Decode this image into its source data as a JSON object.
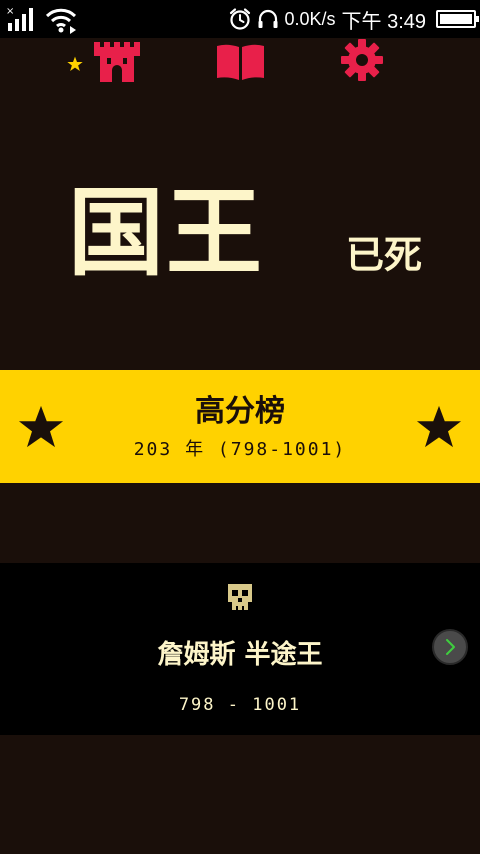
{
  "colors": {
    "background": "#1a0f0a",
    "accent_red": "#e8204a",
    "banner_yellow": "#ffd200",
    "cream_text": "#fdf5c9",
    "skull": "#d8c98a",
    "next_arrow": "#3ecf3e"
  },
  "status_bar": {
    "net_speed": "0.0K/s",
    "time": "下午 3:49",
    "battery_level": 1.0,
    "icons": [
      "signal-icon",
      "wifi-icon",
      "alarm-icon",
      "headset-icon",
      "battery-icon"
    ]
  },
  "toolbar": {
    "icons": [
      "star-icon",
      "castle-icon",
      "book-icon",
      "gear-icon"
    ]
  },
  "title": {
    "main": "国王",
    "sub": "已死"
  },
  "highscore": {
    "label": "高分榜",
    "years": "203 年 (798-1001)",
    "icons": [
      "star-icon",
      "star-icon"
    ]
  },
  "record": {
    "icon": "skull-icon",
    "name": "詹姆斯  半途王",
    "years": "798 - 1001",
    "next_icon": "chevron-right-icon"
  }
}
